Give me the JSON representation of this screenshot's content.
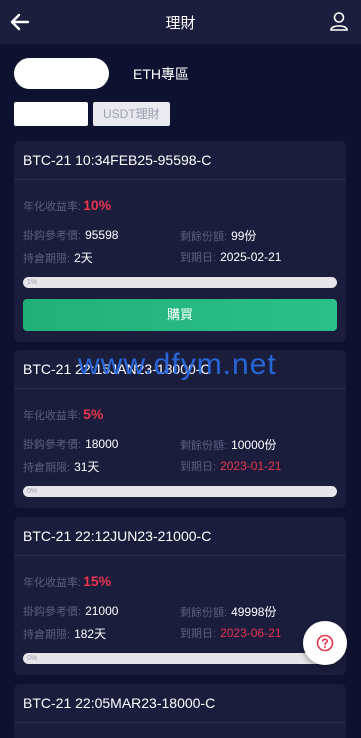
{
  "header": {
    "title": "理財",
    "back_icon": "arrow-left-icon",
    "user_icon": "user-icon"
  },
  "tabs": {
    "primary_label": "ETH專區",
    "secondary_label": "USDT理財"
  },
  "labels": {
    "rate": "年化收益率:",
    "ref_price": "掛鈎參考價:",
    "remaining": "剩餘份額:",
    "period": "持倉期限:",
    "maturity": "到期日:",
    "buy": "購買"
  },
  "products": [
    {
      "title": "BTC-21 10:34FEB25-95598-C",
      "rate": "10%",
      "ref_price": "95598",
      "remaining": "99份",
      "period": "2天",
      "maturity": "2025-02-21",
      "maturity_expired": false,
      "progress_text": "1%",
      "progress": 0.01
    },
    {
      "title": "BTC-21 22:15JAN23-18000-C",
      "rate": "5%",
      "ref_price": "18000",
      "remaining": "10000份",
      "period": "31天",
      "maturity": "2023-01-21",
      "maturity_expired": true,
      "progress_text": "0%",
      "progress": 0
    },
    {
      "title": "BTC-21 22:12JUN23-21000-C",
      "rate": "15%",
      "ref_price": "21000",
      "remaining": "49998份",
      "period": "182天",
      "maturity": "2023-06-21",
      "maturity_expired": true,
      "progress_text": "0%",
      "progress": 0
    },
    {
      "title": "BTC-21 22:05MAR23-18000-C"
    }
  ],
  "watermark": "www.dfym.net",
  "float_button": {
    "icon": "help-icon"
  },
  "colors": {
    "background": "#0f1130",
    "card": "#1b1d3d",
    "accent_red": "#e8344c",
    "buy_green": "#25b57f"
  }
}
